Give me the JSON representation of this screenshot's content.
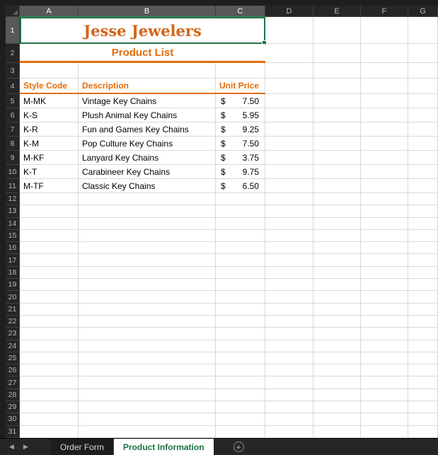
{
  "workbook": {
    "column_headers": [
      "A",
      "B",
      "C",
      "D",
      "E",
      "F",
      "G"
    ],
    "selected_column_headers": [
      "A",
      "B",
      "C"
    ],
    "visible_row_start": 1,
    "visible_row_end": 31,
    "selected_row_header": 1
  },
  "cells": {
    "title": "Jesse Jewelers",
    "subtitle": "Product List"
  },
  "product_table": {
    "headers": {
      "style_code": "Style Code",
      "description": "Description",
      "unit_price": "Unit Price"
    },
    "currency_symbol": "$",
    "rows": [
      {
        "style_code": "M-MK",
        "description": "Vintage Key Chains",
        "price": "7.50"
      },
      {
        "style_code": "K-S",
        "description": "Plush Animal Key Chains",
        "price": "5.95"
      },
      {
        "style_code": "K-R",
        "description": "Fun and Games Key Chains",
        "price": "9.25"
      },
      {
        "style_code": "K-M",
        "description": "Pop Culture Key Chains",
        "price": "7.50"
      },
      {
        "style_code": "M-KF",
        "description": "Lanyard Key Chains",
        "price": "3.75"
      },
      {
        "style_code": "K-T",
        "description": "Carabineer Key Chains",
        "price": "9.75"
      },
      {
        "style_code": "M-TF",
        "description": "Classic Key Chains",
        "price": "6.50"
      }
    ]
  },
  "sheet_bar": {
    "nav_prev": "◀",
    "nav_next": "▶",
    "tabs": [
      {
        "label": "Order Form",
        "active": false
      },
      {
        "label": "Product Information",
        "active": true
      }
    ],
    "add_sheet_label": "+"
  },
  "colors": {
    "accent_orange": "#e36c0a",
    "title_orange": "#d2651a",
    "selection_green": "#217346",
    "active_tab_green": "#1e7145"
  }
}
